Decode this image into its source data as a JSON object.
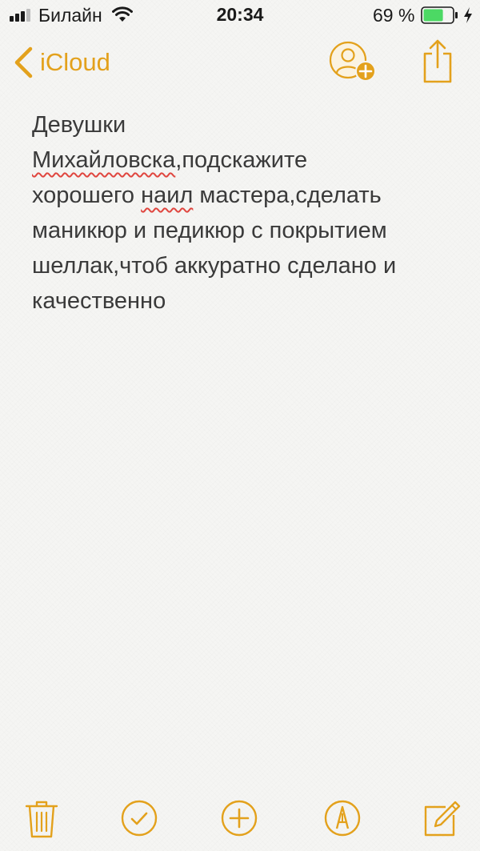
{
  "status_bar": {
    "carrier": "Билайн",
    "time": "20:34",
    "battery_percent": "69 %",
    "battery_level": 0.69
  },
  "nav": {
    "back_label": "iCloud"
  },
  "note": {
    "lines": [
      [
        {
          "text": "Девушки"
        }
      ],
      [
        {
          "text": "Михайловска",
          "misspelled": true
        },
        {
          "text": ",подскажите"
        }
      ],
      [
        {
          "text": "хорошего "
        },
        {
          "text": "наил",
          "misspelled": true
        },
        {
          "text": " мастера,сделать"
        }
      ],
      [
        {
          "text": "маникюр и педикюр с покрытием"
        }
      ],
      [
        {
          "text": "шеллак,чтоб аккуратно сделано и"
        }
      ],
      [
        {
          "text": "качественно"
        }
      ]
    ]
  },
  "colors": {
    "accent": "#e3a11c",
    "text": "#3a3a3a",
    "spell_error": "#e0463f",
    "battery_fill": "#4cd964"
  },
  "icons": {
    "signal": "signal-bars-icon",
    "wifi": "wifi-icon",
    "battery": "battery-icon",
    "charging": "charging-bolt-icon",
    "back": "chevron-left-icon",
    "add_person": "add-person-icon",
    "share": "share-icon",
    "trash": "trash-icon",
    "checklist": "checkmark-circle-icon",
    "add": "plus-circle-icon",
    "markup": "pen-tip-icon",
    "compose": "compose-icon"
  }
}
